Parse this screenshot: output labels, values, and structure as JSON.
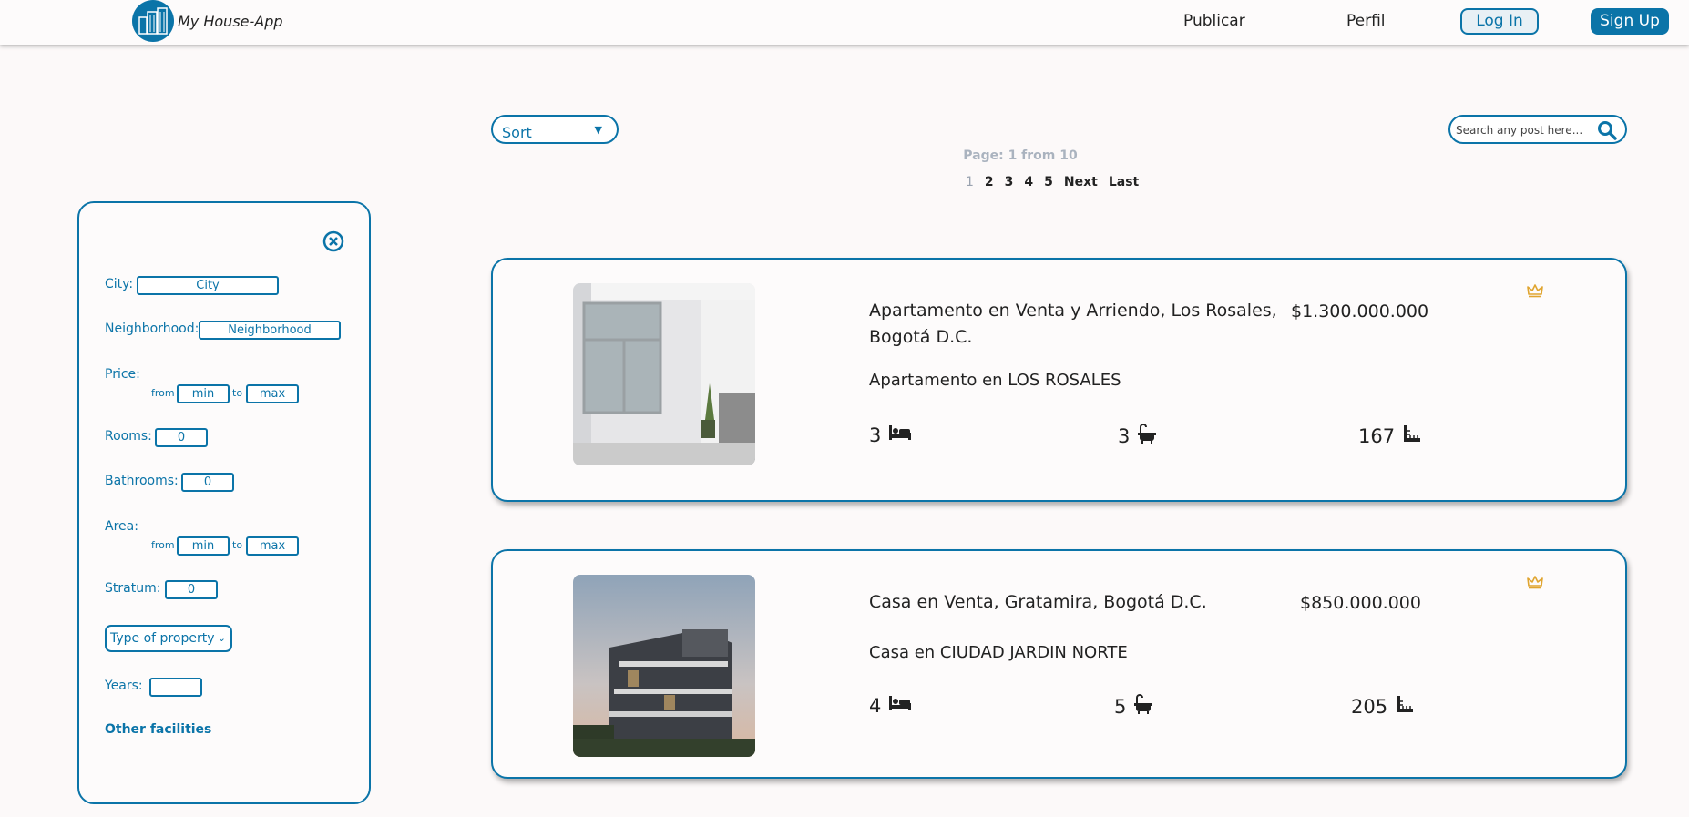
{
  "header": {
    "app_name": "My House-App",
    "nav": {
      "publicar": "Publicar",
      "perfil": "Perfil"
    },
    "login": "Log In",
    "signup": "Sign Up"
  },
  "toolbar": {
    "sort_label": "Sort",
    "search_placeholder": "Search any post here..."
  },
  "pagination": {
    "info": "Page: 1 from 10",
    "pages": [
      "1",
      "2",
      "3",
      "4",
      "5"
    ],
    "next": "Next",
    "last": "Last"
  },
  "filters": {
    "city_label": "City:",
    "city_placeholder": "City",
    "neighborhood_label": "Neighborhood:",
    "neighborhood_placeholder": "Neighborhood",
    "price_label": "Price:",
    "from": "from",
    "to": "to",
    "min": "min",
    "max": "max",
    "rooms_label": "Rooms:",
    "rooms_value": "0",
    "bathrooms_label": "Bathrooms:",
    "bathrooms_value": "0",
    "area_label": "Area:",
    "stratum_label": "Stratum:",
    "stratum_value": "0",
    "type_of_property": "Type of property",
    "years_label": "Years:",
    "years_value": "",
    "other_facilities": "Other facilities"
  },
  "listings": [
    {
      "title": "Apartamento en Venta y Arriendo, Los Rosales, Bogotá D.C.",
      "price": "$1.300.000.000",
      "subtitle": "Apartamento en LOS ROSALES",
      "rooms": "3",
      "baths": "3",
      "area": "167"
    },
    {
      "title": "Casa en Venta, Gratamira, Bogotá D.C.",
      "price": "$850.000.000",
      "subtitle": "Casa en CIUDAD JARDIN NORTE",
      "rooms": "4",
      "baths": "5",
      "area": "205"
    }
  ],
  "colors": {
    "brand": "#0b74a8",
    "crown": "#e0a530"
  }
}
